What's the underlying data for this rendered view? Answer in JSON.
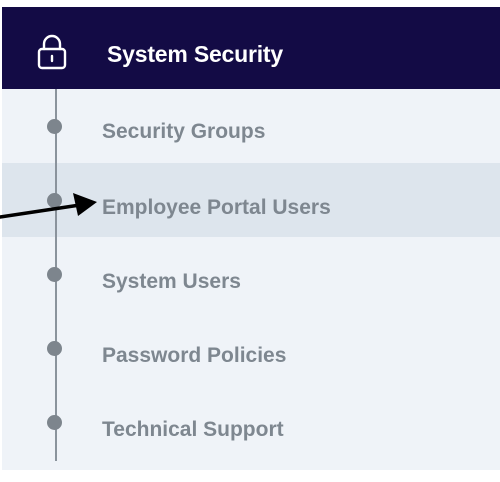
{
  "header": {
    "title": "System Security",
    "icon": "lock-icon"
  },
  "menu": {
    "items": [
      {
        "label": "Security Groups",
        "active": false
      },
      {
        "label": "Employee Portal Users",
        "active": true
      },
      {
        "label": "System Users",
        "active": false
      },
      {
        "label": "Password Policies",
        "active": false
      },
      {
        "label": "Technical Support",
        "active": false
      }
    ]
  },
  "annotation": {
    "icon": "pointer-arrow-icon",
    "target": "Employee Portal Users"
  },
  "colors": {
    "header_bg": "#130b45",
    "menu_bg": "#eff3f8",
    "active_bg": "#dde5ed",
    "label_text": "#7e8790",
    "timeline": "#8a939c"
  }
}
